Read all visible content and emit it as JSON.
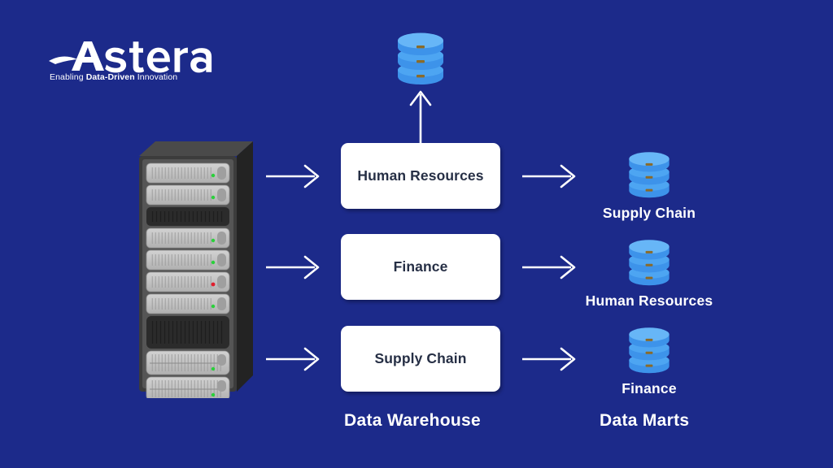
{
  "background_color": "#1c2a8a",
  "logo": {
    "name": "Astera",
    "tagline_prefix": "Enabling ",
    "tagline_bold": "Data-Driven",
    "tagline_suffix": " Innovation",
    "color": "#ffffff"
  },
  "source": {
    "icon": "server-rack-icon",
    "status_lights": [
      "green",
      "green",
      "green",
      "green",
      "red",
      "green",
      "green",
      "green"
    ]
  },
  "top_database": {
    "icon": "database-icon",
    "color": "#4da5f2"
  },
  "warehouse": {
    "caption": "Data Warehouse",
    "box_color": "#ffffff",
    "text_color": "#262f45",
    "boxes": [
      {
        "label": "Human Resources"
      },
      {
        "label": "Finance"
      },
      {
        "label": "Supply Chain"
      }
    ]
  },
  "marts": {
    "caption": "Data Marts",
    "icon_color": "#4da5f2",
    "label_color": "#ffffff",
    "items": [
      {
        "label": "Supply Chain",
        "icon": "database-icon"
      },
      {
        "label": "Human Resources",
        "icon": "database-icon"
      },
      {
        "label": "Finance",
        "icon": "database-icon"
      }
    ]
  },
  "arrows": {
    "color": "#ffffff",
    "inbound": [
      {
        "name": "arrow-source-to-hr"
      },
      {
        "name": "arrow-source-to-finance"
      },
      {
        "name": "arrow-source-to-supply-chain"
      }
    ],
    "outbound": [
      {
        "name": "arrow-hr-to-supply-chain-mart"
      },
      {
        "name": "arrow-finance-to-hr-mart"
      },
      {
        "name": "arrow-supply-chain-to-finance-mart"
      }
    ],
    "upward": {
      "name": "arrow-warehouse-to-database"
    }
  }
}
